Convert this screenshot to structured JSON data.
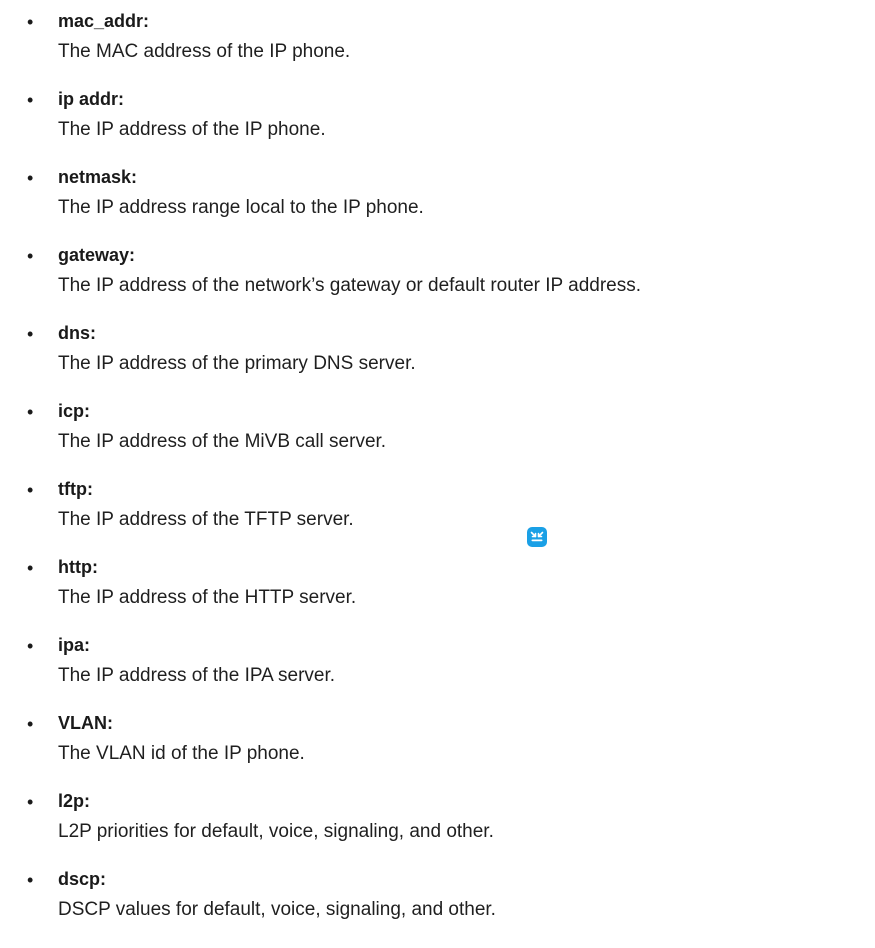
{
  "parameters": [
    {
      "term": "mac_addr:",
      "description": "The MAC address of the IP phone."
    },
    {
      "term": "ip addr:",
      "description": "The IP address of the IP phone."
    },
    {
      "term": "netmask:",
      "description": "The IP address range local to the IP phone."
    },
    {
      "term": "gateway:",
      "description": "The IP address of the network’s gateway or default router IP address."
    },
    {
      "term": "dns:",
      "description": "The IP address of the primary DNS server."
    },
    {
      "term": "icp:",
      "description": "The IP address of the MiVB call server."
    },
    {
      "term": "tftp:",
      "description": "The IP address of the TFTP server."
    },
    {
      "term": "http:",
      "description": "The IP address of the HTTP server."
    },
    {
      "term": "ipa:",
      "description": "The IP address of the IPA server."
    },
    {
      "term": "VLAN:",
      "description": "The VLAN id of the IP phone."
    },
    {
      "term": "l2p:",
      "description": "L2P priorities for default, voice, signaling, and other."
    },
    {
      "term": "dscp:",
      "description": "DSCP values for default, voice, signaling, and other."
    }
  ],
  "bullet_char": "•",
  "floating_button": {
    "icon": "collapse-arrows-icon",
    "color": "#1aa0e6"
  }
}
